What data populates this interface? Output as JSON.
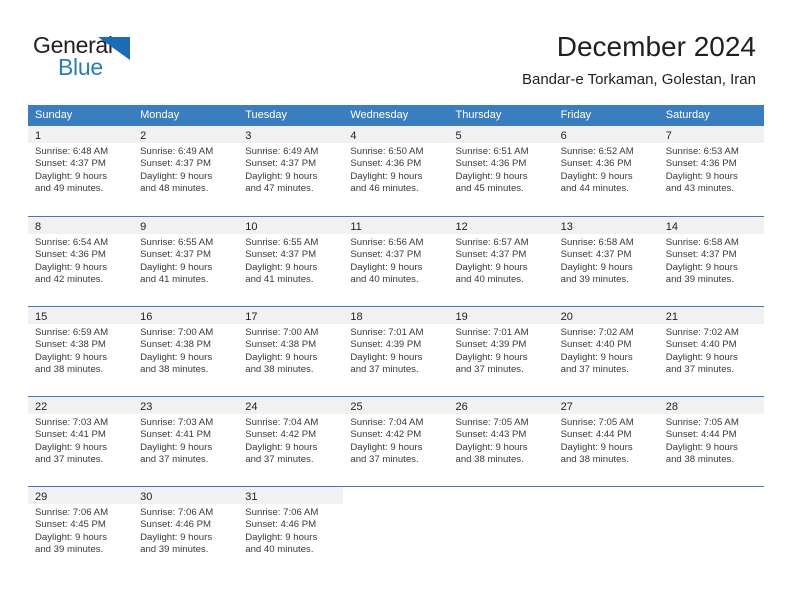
{
  "brand": {
    "name_part1": "General",
    "name_part2": "Blue",
    "triangle_color": "#1b6cb5",
    "blue_text_color": "#2b7cc3"
  },
  "header": {
    "title": "December 2024",
    "subtitle": "Bandar-e Torkaman, Golestan, Iran"
  },
  "theme": {
    "header_bg": "#3a7ebf",
    "header_text": "#ffffff",
    "daynum_band_bg": "#f1f1f1",
    "body_text": "#231f20",
    "info_text": "#3a3a3a",
    "page_bg": "#ffffff"
  },
  "calendar": {
    "weekday_headers": [
      "Sunday",
      "Monday",
      "Tuesday",
      "Wednesday",
      "Thursday",
      "Friday",
      "Saturday"
    ],
    "weeks": [
      [
        {
          "day": "1",
          "sunrise": "Sunrise: 6:48 AM",
          "sunset": "Sunset: 4:37 PM",
          "daylight1": "Daylight: 9 hours",
          "daylight2": "and 49 minutes."
        },
        {
          "day": "2",
          "sunrise": "Sunrise: 6:49 AM",
          "sunset": "Sunset: 4:37 PM",
          "daylight1": "Daylight: 9 hours",
          "daylight2": "and 48 minutes."
        },
        {
          "day": "3",
          "sunrise": "Sunrise: 6:49 AM",
          "sunset": "Sunset: 4:37 PM",
          "daylight1": "Daylight: 9 hours",
          "daylight2": "and 47 minutes."
        },
        {
          "day": "4",
          "sunrise": "Sunrise: 6:50 AM",
          "sunset": "Sunset: 4:36 PM",
          "daylight1": "Daylight: 9 hours",
          "daylight2": "and 46 minutes."
        },
        {
          "day": "5",
          "sunrise": "Sunrise: 6:51 AM",
          "sunset": "Sunset: 4:36 PM",
          "daylight1": "Daylight: 9 hours",
          "daylight2": "and 45 minutes."
        },
        {
          "day": "6",
          "sunrise": "Sunrise: 6:52 AM",
          "sunset": "Sunset: 4:36 PM",
          "daylight1": "Daylight: 9 hours",
          "daylight2": "and 44 minutes."
        },
        {
          "day": "7",
          "sunrise": "Sunrise: 6:53 AM",
          "sunset": "Sunset: 4:36 PM",
          "daylight1": "Daylight: 9 hours",
          "daylight2": "and 43 minutes."
        }
      ],
      [
        {
          "day": "8",
          "sunrise": "Sunrise: 6:54 AM",
          "sunset": "Sunset: 4:36 PM",
          "daylight1": "Daylight: 9 hours",
          "daylight2": "and 42 minutes."
        },
        {
          "day": "9",
          "sunrise": "Sunrise: 6:55 AM",
          "sunset": "Sunset: 4:37 PM",
          "daylight1": "Daylight: 9 hours",
          "daylight2": "and 41 minutes."
        },
        {
          "day": "10",
          "sunrise": "Sunrise: 6:55 AM",
          "sunset": "Sunset: 4:37 PM",
          "daylight1": "Daylight: 9 hours",
          "daylight2": "and 41 minutes."
        },
        {
          "day": "11",
          "sunrise": "Sunrise: 6:56 AM",
          "sunset": "Sunset: 4:37 PM",
          "daylight1": "Daylight: 9 hours",
          "daylight2": "and 40 minutes."
        },
        {
          "day": "12",
          "sunrise": "Sunrise: 6:57 AM",
          "sunset": "Sunset: 4:37 PM",
          "daylight1": "Daylight: 9 hours",
          "daylight2": "and 40 minutes."
        },
        {
          "day": "13",
          "sunrise": "Sunrise: 6:58 AM",
          "sunset": "Sunset: 4:37 PM",
          "daylight1": "Daylight: 9 hours",
          "daylight2": "and 39 minutes."
        },
        {
          "day": "14",
          "sunrise": "Sunrise: 6:58 AM",
          "sunset": "Sunset: 4:37 PM",
          "daylight1": "Daylight: 9 hours",
          "daylight2": "and 39 minutes."
        }
      ],
      [
        {
          "day": "15",
          "sunrise": "Sunrise: 6:59 AM",
          "sunset": "Sunset: 4:38 PM",
          "daylight1": "Daylight: 9 hours",
          "daylight2": "and 38 minutes."
        },
        {
          "day": "16",
          "sunrise": "Sunrise: 7:00 AM",
          "sunset": "Sunset: 4:38 PM",
          "daylight1": "Daylight: 9 hours",
          "daylight2": "and 38 minutes."
        },
        {
          "day": "17",
          "sunrise": "Sunrise: 7:00 AM",
          "sunset": "Sunset: 4:38 PM",
          "daylight1": "Daylight: 9 hours",
          "daylight2": "and 38 minutes."
        },
        {
          "day": "18",
          "sunrise": "Sunrise: 7:01 AM",
          "sunset": "Sunset: 4:39 PM",
          "daylight1": "Daylight: 9 hours",
          "daylight2": "and 37 minutes."
        },
        {
          "day": "19",
          "sunrise": "Sunrise: 7:01 AM",
          "sunset": "Sunset: 4:39 PM",
          "daylight1": "Daylight: 9 hours",
          "daylight2": "and 37 minutes."
        },
        {
          "day": "20",
          "sunrise": "Sunrise: 7:02 AM",
          "sunset": "Sunset: 4:40 PM",
          "daylight1": "Daylight: 9 hours",
          "daylight2": "and 37 minutes."
        },
        {
          "day": "21",
          "sunrise": "Sunrise: 7:02 AM",
          "sunset": "Sunset: 4:40 PM",
          "daylight1": "Daylight: 9 hours",
          "daylight2": "and 37 minutes."
        }
      ],
      [
        {
          "day": "22",
          "sunrise": "Sunrise: 7:03 AM",
          "sunset": "Sunset: 4:41 PM",
          "daylight1": "Daylight: 9 hours",
          "daylight2": "and 37 minutes."
        },
        {
          "day": "23",
          "sunrise": "Sunrise: 7:03 AM",
          "sunset": "Sunset: 4:41 PM",
          "daylight1": "Daylight: 9 hours",
          "daylight2": "and 37 minutes."
        },
        {
          "day": "24",
          "sunrise": "Sunrise: 7:04 AM",
          "sunset": "Sunset: 4:42 PM",
          "daylight1": "Daylight: 9 hours",
          "daylight2": "and 37 minutes."
        },
        {
          "day": "25",
          "sunrise": "Sunrise: 7:04 AM",
          "sunset": "Sunset: 4:42 PM",
          "daylight1": "Daylight: 9 hours",
          "daylight2": "and 37 minutes."
        },
        {
          "day": "26",
          "sunrise": "Sunrise: 7:05 AM",
          "sunset": "Sunset: 4:43 PM",
          "daylight1": "Daylight: 9 hours",
          "daylight2": "and 38 minutes."
        },
        {
          "day": "27",
          "sunrise": "Sunrise: 7:05 AM",
          "sunset": "Sunset: 4:44 PM",
          "daylight1": "Daylight: 9 hours",
          "daylight2": "and 38 minutes."
        },
        {
          "day": "28",
          "sunrise": "Sunrise: 7:05 AM",
          "sunset": "Sunset: 4:44 PM",
          "daylight1": "Daylight: 9 hours",
          "daylight2": "and 38 minutes."
        }
      ],
      [
        {
          "day": "29",
          "sunrise": "Sunrise: 7:06 AM",
          "sunset": "Sunset: 4:45 PM",
          "daylight1": "Daylight: 9 hours",
          "daylight2": "and 39 minutes."
        },
        {
          "day": "30",
          "sunrise": "Sunrise: 7:06 AM",
          "sunset": "Sunset: 4:46 PM",
          "daylight1": "Daylight: 9 hours",
          "daylight2": "and 39 minutes."
        },
        {
          "day": "31",
          "sunrise": "Sunrise: 7:06 AM",
          "sunset": "Sunset: 4:46 PM",
          "daylight1": "Daylight: 9 hours",
          "daylight2": "and 40 minutes."
        },
        {
          "day": "",
          "sunrise": "",
          "sunset": "",
          "daylight1": "",
          "daylight2": ""
        },
        {
          "day": "",
          "sunrise": "",
          "sunset": "",
          "daylight1": "",
          "daylight2": ""
        },
        {
          "day": "",
          "sunrise": "",
          "sunset": "",
          "daylight1": "",
          "daylight2": ""
        },
        {
          "day": "",
          "sunrise": "",
          "sunset": "",
          "daylight1": "",
          "daylight2": ""
        }
      ]
    ]
  }
}
